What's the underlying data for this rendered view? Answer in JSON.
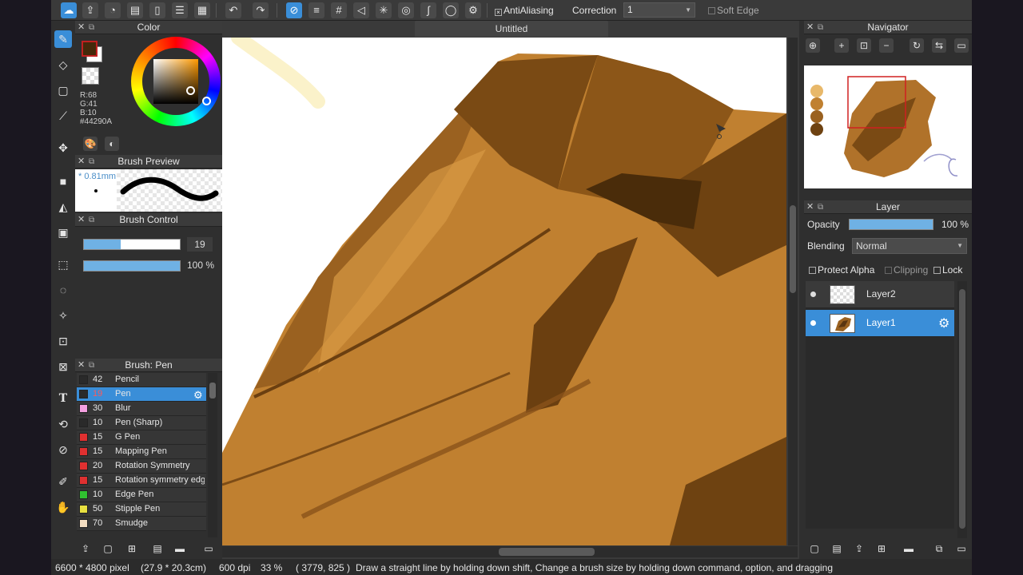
{
  "app": {
    "canvas_title": "Untitled"
  },
  "toolbar": {
    "antialiasing_label": "AntiAliasing",
    "correction_label": "Correction",
    "correction_value": "1",
    "soft_edge_label": "Soft Edge"
  },
  "color_panel": {
    "title": "Color",
    "r": "R:68",
    "g": "G:41",
    "b": "B:10",
    "hex": "#44290A",
    "primary_color": "#44290a"
  },
  "brush_preview": {
    "title": "Brush Preview",
    "size": "* 0.81mm"
  },
  "brush_control": {
    "title": "Brush Control",
    "size_value": "19",
    "opacity_value": "100 %",
    "size_fraction": 0.38,
    "opacity_fraction": 1.0
  },
  "brush_list": {
    "title": "Brush: Pen",
    "items": [
      {
        "size": "42",
        "name": "Pencil",
        "color": "#2a2a2a"
      },
      {
        "size": "19",
        "name": "Pen",
        "color": "#2a2a2a"
      },
      {
        "size": "30",
        "name": "Blur",
        "color": "#f4a0e0"
      },
      {
        "size": "10",
        "name": "Pen (Sharp)",
        "color": "#2a2a2a"
      },
      {
        "size": "15",
        "name": "G Pen",
        "color": "#e03030"
      },
      {
        "size": "15",
        "name": "Mapping Pen",
        "color": "#e03030"
      },
      {
        "size": "20",
        "name": "Rotation Symmetry",
        "color": "#e03030"
      },
      {
        "size": "15",
        "name": "Rotation symmetry edge",
        "color": "#e03030"
      },
      {
        "size": "10",
        "name": "Edge Pen",
        "color": "#30c030"
      },
      {
        "size": "50",
        "name": "Stipple Pen",
        "color": "#e8e040"
      },
      {
        "size": "70",
        "name": "Smudge",
        "color": "#f2dcc0"
      }
    ]
  },
  "navigator": {
    "title": "Navigator"
  },
  "layer_panel": {
    "title": "Layer",
    "opacity_label": "Opacity",
    "opacity_value": "100 %",
    "opacity_fraction": 1.0,
    "blending_label": "Blending",
    "blending_value": "Normal",
    "protect_alpha_label": "Protect Alpha",
    "clipping_label": "Clipping",
    "lock_label": "Lock",
    "layers": [
      {
        "name": "Layer2"
      },
      {
        "name": "Layer1"
      }
    ]
  },
  "status": {
    "size": "6600 * 4800 pixel",
    "physical": "(27.9 * 20.3cm)",
    "dpi": "600 dpi",
    "zoom": "33 %",
    "cursor": "( 3779, 825 )",
    "hint": "Draw a straight line by holding down shift, Change a brush size by holding down command, option, and dragging"
  }
}
